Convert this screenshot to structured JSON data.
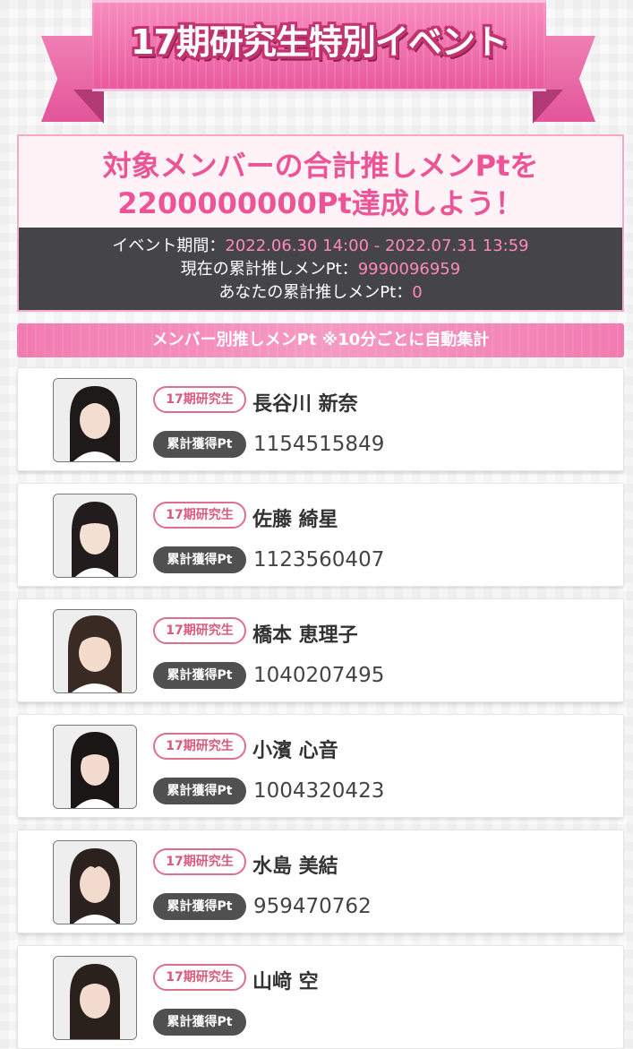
{
  "banner": {
    "title": "17期研究生特別イベント"
  },
  "goal": {
    "line1": "対象メンバーの合計推しメンPtを",
    "line2": "2200000000Pt達成しよう！",
    "period_label": "イベント期間：",
    "period_value": "2022.06.30 14:00 - 2022.07.31 13:59",
    "cumulative_label": "現在の累計推しメンPt：",
    "cumulative_value": "9990096959",
    "your_label": "あなたの累計推しメンPt：",
    "your_value": "0"
  },
  "section": {
    "title": "メンバー別推しメンPt ※10分ごとに自動集計"
  },
  "members": [
    {
      "generation": "17期研究生",
      "name": "長谷川 新奈",
      "pt_label": "累計獲得Pt",
      "points": "1154515849"
    },
    {
      "generation": "17期研究生",
      "name": "佐藤 綺星",
      "pt_label": "累計獲得Pt",
      "points": "1123560407"
    },
    {
      "generation": "17期研究生",
      "name": "橋本 恵理子",
      "pt_label": "累計獲得Pt",
      "points": "1040207495"
    },
    {
      "generation": "17期研究生",
      "name": "小濱 心音",
      "pt_label": "累計獲得Pt",
      "points": "1004320423"
    },
    {
      "generation": "17期研究生",
      "name": "水島 美結",
      "pt_label": "累計獲得Pt",
      "points": "959470762"
    },
    {
      "generation": "17期研究生",
      "name": "山﨑 空",
      "pt_label": "累計獲得Pt",
      "points": ""
    }
  ],
  "colors": {
    "accent_pink": "#ec5496",
    "dark_panel": "#454448",
    "badge_red": "#e06f8c"
  }
}
